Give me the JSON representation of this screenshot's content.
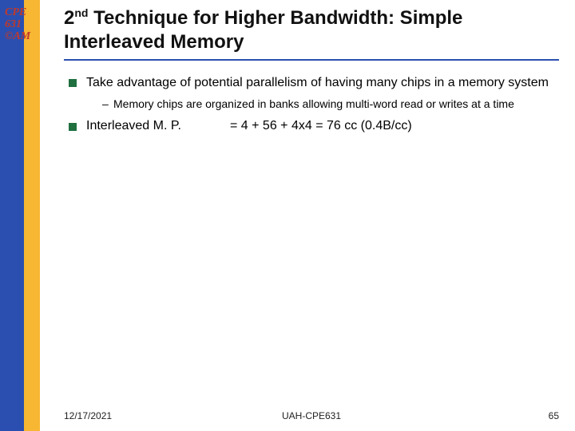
{
  "logo": {
    "line1": "CPE",
    "line2": "631",
    "line3": "©AM"
  },
  "title": {
    "prefix": "2",
    "sup": "nd",
    "rest": " Technique for Higher Bandwidth: Simple Interleaved Memory"
  },
  "bullets": [
    {
      "text": "Take advantage of potential parallelism of having many chips in a memory system",
      "sub": "Memory chips are organized in banks allowing multi-word read or writes at a time"
    },
    {
      "label": "Interleaved M. P.",
      "value": "= 4 + 56 + 4x4  = 76 cc (0.4B/cc)"
    }
  ],
  "footer": {
    "date": "12/17/2021",
    "center": "UAH-CPE631",
    "page": "65"
  }
}
